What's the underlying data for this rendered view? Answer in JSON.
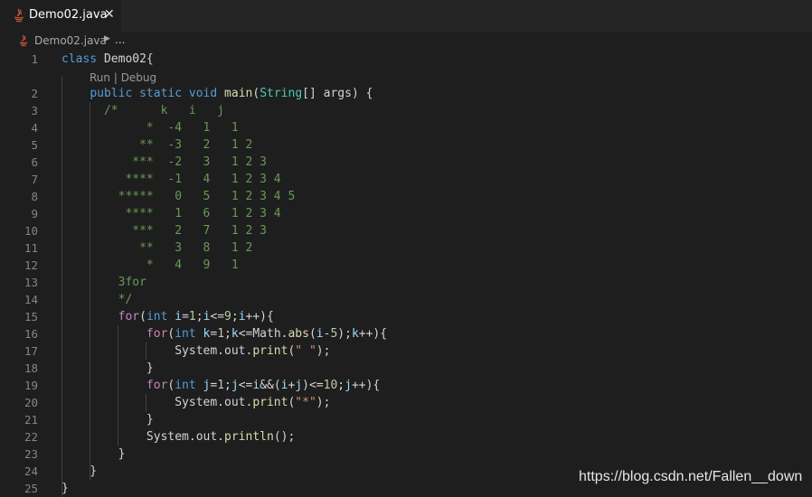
{
  "tab": {
    "label": "Demo02.java",
    "close": "✕"
  },
  "breadcrumb": {
    "file": "Demo02.java",
    "more": "..."
  },
  "codelens": {
    "run": "Run",
    "sep": " | ",
    "debug": "Debug"
  },
  "lines": [
    {
      "n": "1",
      "segs": [
        [
          "class",
          "kw"
        ],
        [
          " Demo02{",
          ""
        ]
      ]
    },
    {
      "n": "2",
      "segs": [
        [
          "    ",
          ""
        ],
        [
          "public",
          "kw"
        ],
        [
          " ",
          ""
        ],
        [
          "static",
          "kw"
        ],
        [
          " ",
          ""
        ],
        [
          "void",
          "kw"
        ],
        [
          " ",
          ""
        ],
        [
          "main",
          "fn"
        ],
        [
          "(",
          ""
        ],
        [
          "String",
          "ty"
        ],
        [
          "[] args) {",
          ""
        ]
      ]
    },
    {
      "n": "3",
      "segs": [
        [
          "      /*      k   i   j",
          "cm"
        ]
      ]
    },
    {
      "n": "4",
      "segs": [
        [
          "            *  -4   1   1",
          "cm"
        ]
      ]
    },
    {
      "n": "5",
      "segs": [
        [
          "           **  -3   2   1 2",
          "cm"
        ]
      ]
    },
    {
      "n": "6",
      "segs": [
        [
          "          ***  -2   3   1 2 3",
          "cm"
        ]
      ]
    },
    {
      "n": "7",
      "segs": [
        [
          "         ****  -1   4   1 2 3 4",
          "cm"
        ]
      ]
    },
    {
      "n": "8",
      "segs": [
        [
          "        *****   0   5   1 2 3 4 5",
          "cm"
        ]
      ]
    },
    {
      "n": "9",
      "segs": [
        [
          "         ****   1   6   1 2 3 4",
          "cm"
        ]
      ]
    },
    {
      "n": "10",
      "segs": [
        [
          "          ***   2   7   1 2 3",
          "cm"
        ]
      ]
    },
    {
      "n": "11",
      "segs": [
        [
          "           **   3   8   1 2",
          "cm"
        ]
      ]
    },
    {
      "n": "12",
      "segs": [
        [
          "            *   4   9   1",
          "cm"
        ]
      ]
    },
    {
      "n": "13",
      "segs": [
        [
          "        3for",
          "cm"
        ]
      ]
    },
    {
      "n": "14",
      "segs": [
        [
          "        */",
          "cm"
        ]
      ]
    },
    {
      "n": "15",
      "segs": [
        [
          "        ",
          ""
        ],
        [
          "for",
          "kwc"
        ],
        [
          "(",
          ""
        ],
        [
          "int",
          "kw"
        ],
        [
          " ",
          ""
        ],
        [
          "i",
          "var"
        ],
        [
          "=",
          ""
        ],
        [
          "1",
          "num"
        ],
        [
          ";",
          ""
        ],
        [
          "i",
          "var"
        ],
        [
          "<=",
          ""
        ],
        [
          "9",
          "num"
        ],
        [
          ";",
          ""
        ],
        [
          "i",
          "var"
        ],
        [
          "++){",
          ""
        ]
      ]
    },
    {
      "n": "16",
      "segs": [
        [
          "            ",
          ""
        ],
        [
          "for",
          "kwc"
        ],
        [
          "(",
          ""
        ],
        [
          "int",
          "kw"
        ],
        [
          " ",
          ""
        ],
        [
          "k",
          "var"
        ],
        [
          "=",
          ""
        ],
        [
          "1",
          "num"
        ],
        [
          ";",
          ""
        ],
        [
          "k",
          "var"
        ],
        [
          "<=Math.",
          ""
        ],
        [
          "abs",
          "fn"
        ],
        [
          "(",
          ""
        ],
        [
          "i",
          "var"
        ],
        [
          "-",
          ""
        ],
        [
          "5",
          "num"
        ],
        [
          ");",
          ""
        ],
        [
          "k",
          "var"
        ],
        [
          "++){",
          ""
        ]
      ]
    },
    {
      "n": "17",
      "segs": [
        [
          "                System.out.",
          ""
        ],
        [
          "print",
          "fn"
        ],
        [
          "(",
          ""
        ],
        [
          "\" \"",
          "str"
        ],
        [
          ");",
          ""
        ]
      ]
    },
    {
      "n": "18",
      "segs": [
        [
          "            }",
          ""
        ]
      ]
    },
    {
      "n": "19",
      "segs": [
        [
          "            ",
          ""
        ],
        [
          "for",
          "kwc"
        ],
        [
          "(",
          ""
        ],
        [
          "int",
          "kw"
        ],
        [
          " ",
          ""
        ],
        [
          "j",
          "var"
        ],
        [
          "=",
          ""
        ],
        [
          "1",
          "num"
        ],
        [
          ";",
          ""
        ],
        [
          "j",
          "var"
        ],
        [
          "<=",
          ""
        ],
        [
          "i",
          "var"
        ],
        [
          "&&(",
          ""
        ],
        [
          "i",
          "var"
        ],
        [
          "+",
          ""
        ],
        [
          "j",
          "var"
        ],
        [
          ")<=",
          ""
        ],
        [
          "10",
          "num"
        ],
        [
          ";",
          ""
        ],
        [
          "j",
          "var"
        ],
        [
          "++){",
          ""
        ]
      ]
    },
    {
      "n": "20",
      "segs": [
        [
          "                System.out.",
          ""
        ],
        [
          "print",
          "fn"
        ],
        [
          "(",
          ""
        ],
        [
          "\"*\"",
          "str"
        ],
        [
          ");",
          ""
        ]
      ]
    },
    {
      "n": "21",
      "segs": [
        [
          "            }",
          ""
        ]
      ]
    },
    {
      "n": "22",
      "segs": [
        [
          "            System.out.",
          ""
        ],
        [
          "println",
          "fn"
        ],
        [
          "();",
          ""
        ]
      ]
    },
    {
      "n": "23",
      "segs": [
        [
          "        }",
          ""
        ]
      ]
    },
    {
      "n": "24",
      "segs": [
        [
          "    }",
          ""
        ]
      ]
    },
    {
      "n": "25",
      "segs": [
        [
          "}",
          ""
        ]
      ]
    }
  ],
  "watermark": "https://blog.csdn.net/Fallen__down",
  "colors": {
    "background": "#1e1e1e",
    "tabbar": "#252526",
    "keyword": "#569cd6",
    "control_keyword": "#c586c0",
    "type": "#4ec9b0",
    "function": "#dcdcaa",
    "number": "#b5cea8",
    "string": "#ce9178",
    "comment": "#6a9955",
    "variable": "#9cdcfe",
    "java_icon": "#e05a3a"
  }
}
